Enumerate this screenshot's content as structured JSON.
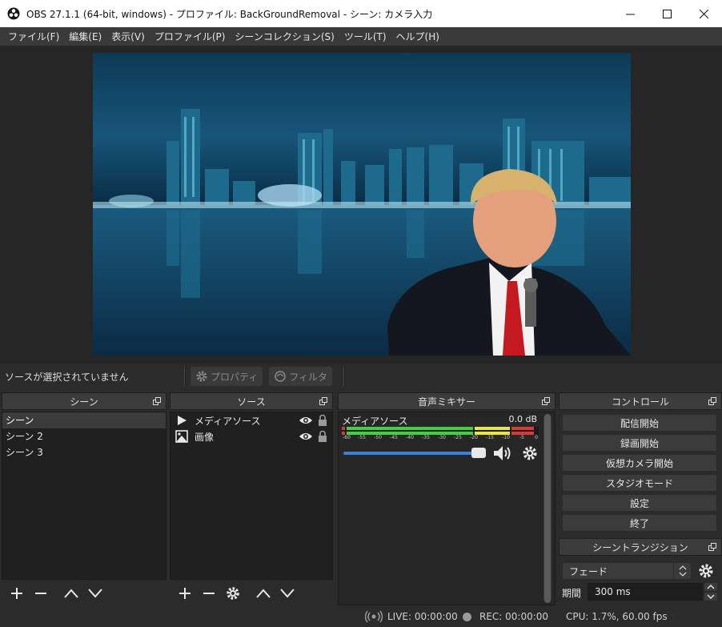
{
  "window": {
    "title": "OBS 27.1.1 (64-bit, windows) - プロファイル: BackGroundRemoval - シーン: カメラ入力"
  },
  "menu": {
    "items": [
      "ファイル(F)",
      "編集(E)",
      "表示(V)",
      "プロファイル(P)",
      "シーンコレクション(S)",
      "ツール(T)",
      "ヘルプ(H)"
    ]
  },
  "context_bar": {
    "status": "ソースが選択されていません",
    "properties_label": "プロパティ",
    "filters_label": "フィルタ"
  },
  "scenes": {
    "title": "シーン",
    "items": [
      "シーン",
      "シーン 2",
      "シーン 3"
    ],
    "selected_index": 0
  },
  "sources": {
    "title": "ソース",
    "items": [
      {
        "label": "メディアソース",
        "icon": "play-icon",
        "visible": true,
        "locked": true
      },
      {
        "label": "画像",
        "icon": "image-icon",
        "visible": true,
        "locked": true
      }
    ]
  },
  "mixer": {
    "title": "音声ミキサー",
    "channel": {
      "name": "メディアソース",
      "level": "0.0 dB",
      "ticks": [
        "-60",
        "-55",
        "-50",
        "-45",
        "-40",
        "-35",
        "-30",
        "-25",
        "-20",
        "-15",
        "-10",
        "-5",
        "0"
      ],
      "volume_fraction": 1.0
    }
  },
  "controls": {
    "title": "コントロール",
    "buttons": [
      "配信開始",
      "録画開始",
      "仮想カメラ開始",
      "スタジオモード",
      "設定",
      "終了"
    ]
  },
  "transitions": {
    "title": "シーントランジション",
    "selected": "フェード",
    "duration_label": "期間",
    "duration_value": "300 ms"
  },
  "status": {
    "live": "LIVE: 00:00:00",
    "rec": "REC: 00:00:00",
    "cpu": "CPU: 1.7%, 60.00 fps"
  },
  "colors": {
    "window_bg": "#2b2b2b",
    "dock_header": "#3c3c3c",
    "list_bg": "#202020",
    "slider_blue": "#3d7ed8",
    "meter_green": "#3fd23f",
    "meter_yellow": "#e8e83a",
    "meter_red": "#d83a3a"
  }
}
